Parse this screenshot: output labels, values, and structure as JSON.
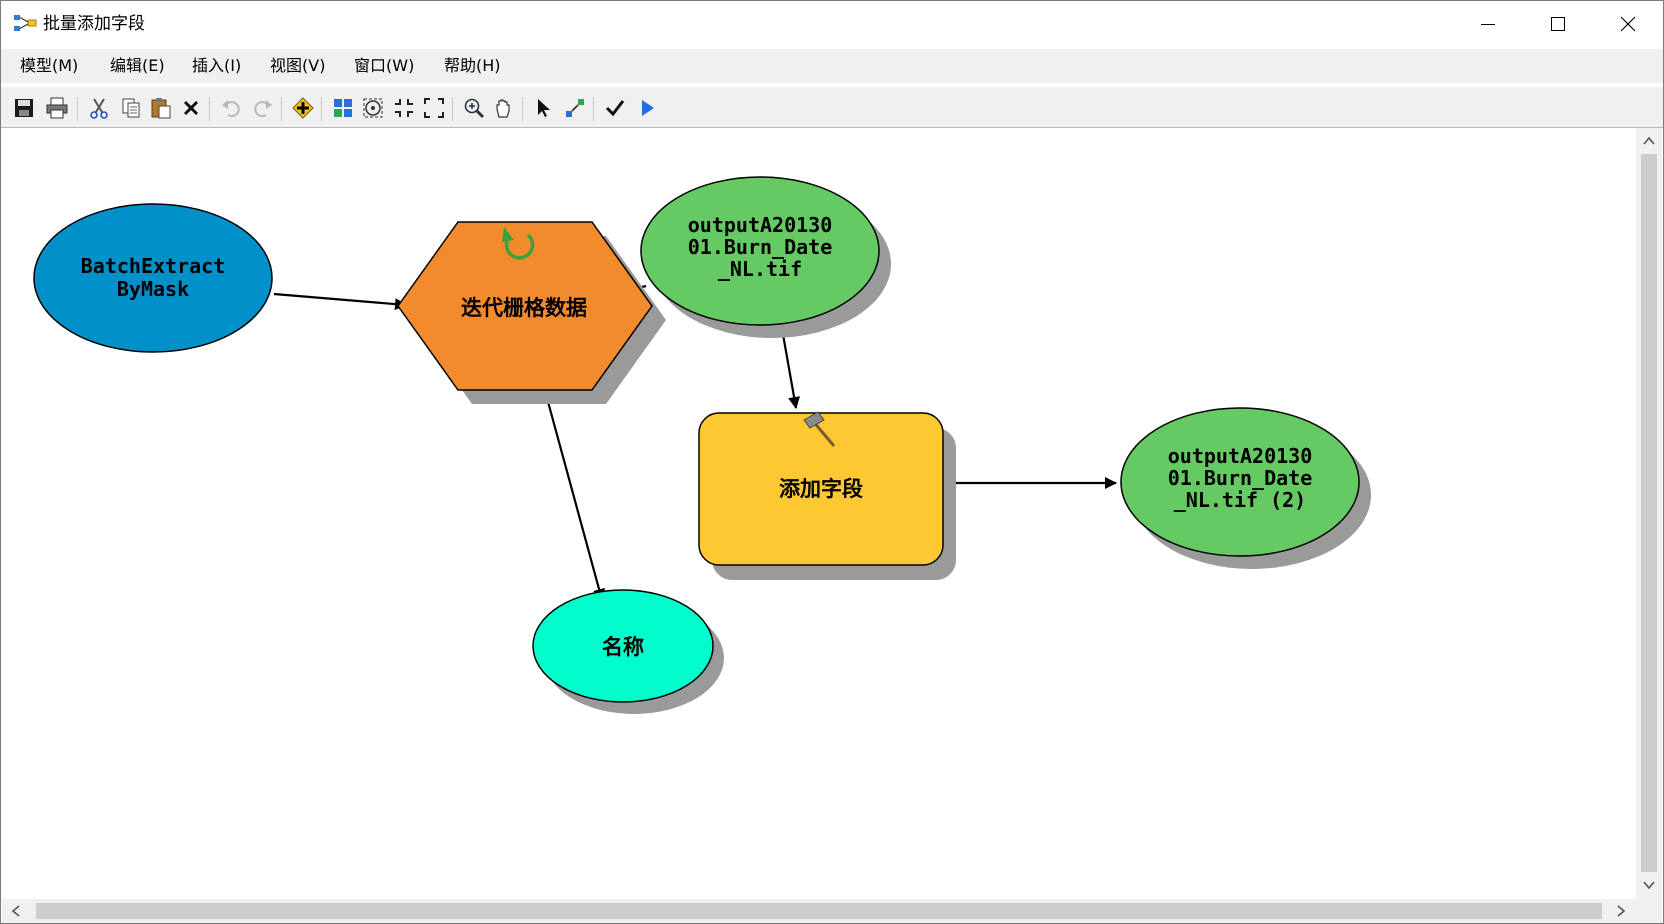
{
  "window": {
    "title": "批量添加字段"
  },
  "menu": [
    {
      "label": "模型(M)"
    },
    {
      "label": "编辑(E)"
    },
    {
      "label": "插入(I)"
    },
    {
      "label": "视图(V)"
    },
    {
      "label": "窗口(W)"
    },
    {
      "label": "帮助(H)"
    }
  ],
  "toolbar": {
    "icons": [
      "save-icon",
      "print-icon",
      "cut-icon",
      "copy-icon",
      "paste-icon",
      "delete-icon",
      "undo-icon",
      "redo-icon",
      "add-data-icon",
      "auto-layout-icon",
      "full-extent-icon",
      "zoom-to-fit-icon",
      "actual-size-icon",
      "zoom-in-icon",
      "pan-icon",
      "select-icon",
      "connect-icon",
      "validate-icon",
      "run-icon"
    ]
  },
  "model": {
    "nodes": {
      "input_data": {
        "line1": "BatchExtract",
        "line2": "ByMask",
        "color": "#0290c8"
      },
      "iterator": {
        "label": "迭代栅格数据",
        "color": "#f28a2e"
      },
      "iter_output": {
        "line1": "outputA20130",
        "line2": "01.Burn_Date",
        "line3": "_NL.tif",
        "color": "#65c964"
      },
      "tool": {
        "label": "添加字段",
        "color": "#fdc831"
      },
      "tool_output": {
        "line1": "outputA20130",
        "line2": "01.Burn_Date",
        "line3": "_NL.tif (2)",
        "color": "#65c964"
      },
      "name_var": {
        "label": "名称",
        "color": "#00fdcb"
      }
    }
  },
  "colors": {
    "shadow": "#9a9a9a",
    "menubar_bg": "#f0f0f0",
    "scrollbar_thumb": "#cdcdcd"
  }
}
